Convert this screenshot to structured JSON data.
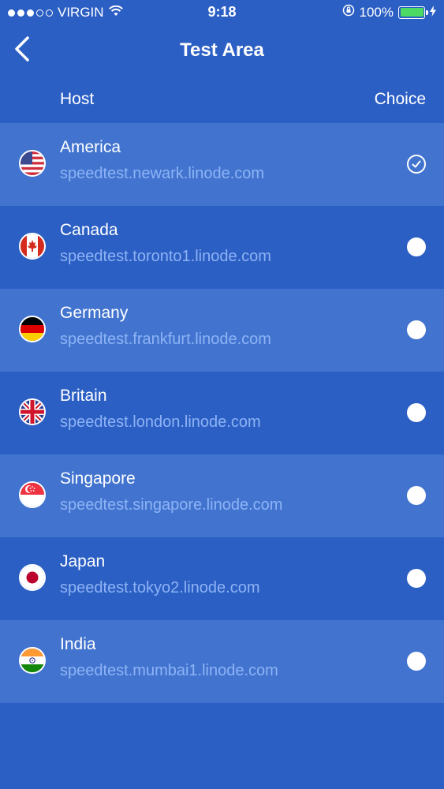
{
  "status_bar": {
    "carrier": "VIRGIN",
    "time": "9:18",
    "battery": "100%"
  },
  "nav": {
    "title": "Test Area"
  },
  "columns": {
    "host": "Host",
    "choice": "Choice"
  },
  "servers": [
    {
      "country": "America",
      "host": "speedtest.newark.linode.com",
      "selected": true
    },
    {
      "country": "Canada",
      "host": "speedtest.toronto1.linode.com",
      "selected": false
    },
    {
      "country": "Germany",
      "host": "speedtest.frankfurt.linode.com",
      "selected": false
    },
    {
      "country": "Britain",
      "host": "speedtest.london.linode.com",
      "selected": false
    },
    {
      "country": "Singapore",
      "host": "speedtest.singapore.linode.com",
      "selected": false
    },
    {
      "country": "Japan",
      "host": "speedtest.tokyo2.linode.com",
      "selected": false
    },
    {
      "country": "India",
      "host": "speedtest.mumbai1.linode.com",
      "selected": false
    }
  ],
  "colors": {
    "background": "#2c5fc4",
    "row_alt": "#4274cf",
    "host_text": "#8db3f5",
    "battery": "#4cd964"
  }
}
